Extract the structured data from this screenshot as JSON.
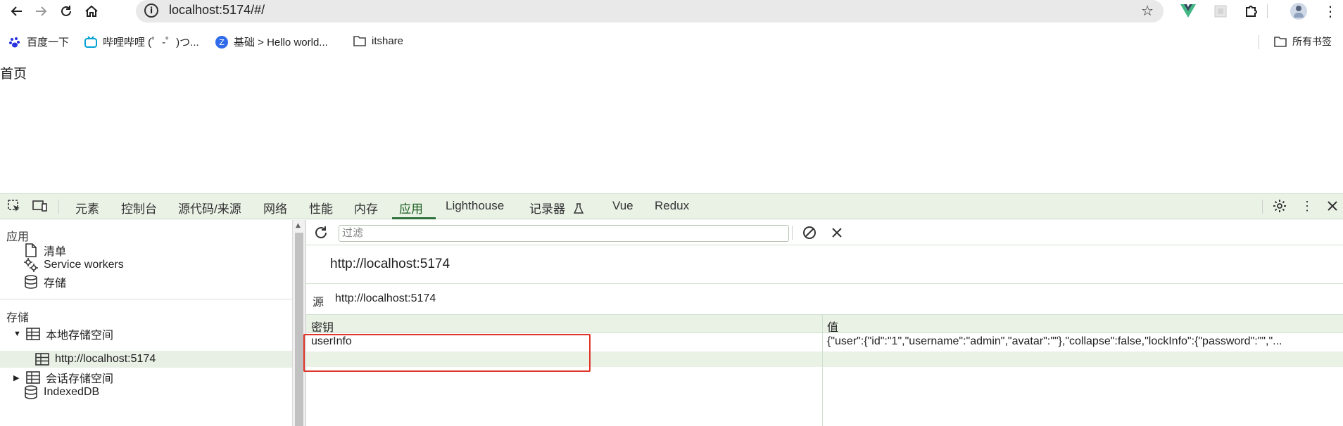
{
  "browser": {
    "url": "localhost:5174/#/",
    "bookmarks": [
      {
        "label": "百度一下"
      },
      {
        "label": "哔哩哔哩 (゜-゜)つ..."
      },
      {
        "label": "基础 > Hello world..."
      },
      {
        "label": "itshare"
      }
    ],
    "all_bookmarks": "所有书签"
  },
  "page": {
    "title": "首页"
  },
  "devtools": {
    "tabs": [
      "元素",
      "控制台",
      "源代码/来源",
      "网络",
      "性能",
      "内存",
      "应用",
      "Lighthouse",
      "记录器",
      "Vue",
      "Redux"
    ],
    "active_tab": "应用",
    "sidebar": {
      "app_header": "应用",
      "manifest": "清单",
      "service_workers": "Service workers",
      "storage_item": "存储",
      "storage_header": "存储",
      "local_storage": "本地存储空间",
      "local_origin": "http://localhost:5174",
      "session_storage": "会话存储空间",
      "indexeddb": "IndexedDB"
    },
    "main": {
      "filter_placeholder": "过滤",
      "origin_title": "http://localhost:5174",
      "origin_label": "源",
      "origin_value": "http://localhost:5174",
      "columns": {
        "key": "密钥",
        "value": "值"
      },
      "rows": [
        {
          "key": "userInfo",
          "value": "{\"user\":{\"id\":\"1\",\"username\":\"admin\",\"avatar\":\"\"},\"collapse\":false,\"lockInfo\":{\"password\":\"\",\"..."
        }
      ]
    },
    "highlight_color": "#e03428",
    "accent_color": "#2f6f3a"
  }
}
